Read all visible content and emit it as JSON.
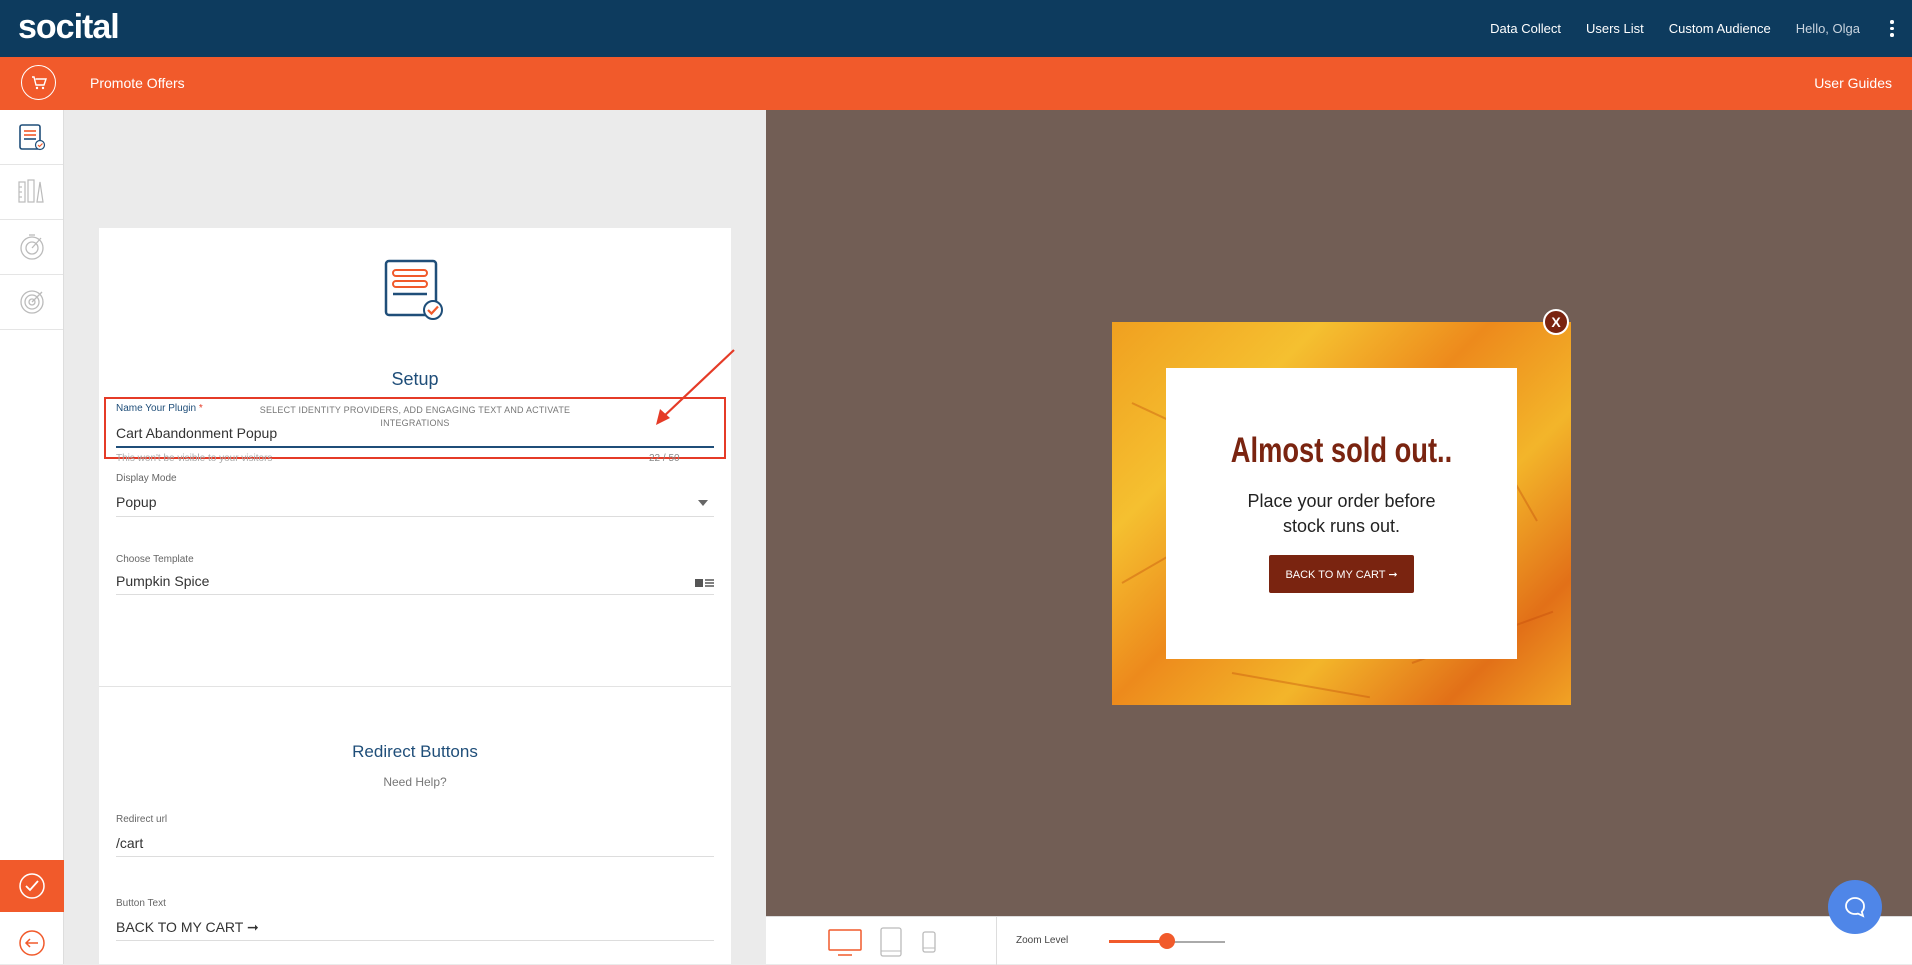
{
  "header": {
    "logo": "socital",
    "nav": [
      "Data Collect",
      "Users List",
      "Custom Audience"
    ],
    "greeting": "Hello, Olga"
  },
  "subheader": {
    "title": "Promote Offers",
    "guides": "User Guides"
  },
  "setup": {
    "title": "Setup",
    "subtitle": "SELECT IDENTITY PROVIDERS, ADD ENGAGING TEXT AND ACTIVATE INTEGRATIONS",
    "plugin_name": {
      "label": "Name Your Plugin",
      "required_mark": "*",
      "value": "Cart Abandonment Popup",
      "hint": "This won't be visible to your visitors",
      "counter": "22 / 50"
    },
    "display_mode": {
      "label": "Display Mode",
      "value": "Popup"
    },
    "template": {
      "label": "Choose Template",
      "value": "Pumpkin Spice"
    }
  },
  "redirect": {
    "title": "Redirect Buttons",
    "help": "Need Help?",
    "url": {
      "label": "Redirect url",
      "value": "/cart"
    },
    "button_text": {
      "label": "Button Text",
      "value": "BACK TO MY CART ➞"
    }
  },
  "popup": {
    "headline": "Almost sold out..",
    "subtext_line1": "Place your order before",
    "subtext_line2": "stock runs out.",
    "cta": "BACK TO MY CART ➞",
    "close": "X"
  },
  "preview_bar": {
    "zoom_label": "Zoom Level",
    "zoom_fraction": 0.5
  },
  "colors": {
    "navy": "#0d3b5e",
    "orange": "#f15a2b",
    "preview_bg": "#725e55",
    "brown": "#7a2410",
    "highlight": "#e53b27"
  }
}
